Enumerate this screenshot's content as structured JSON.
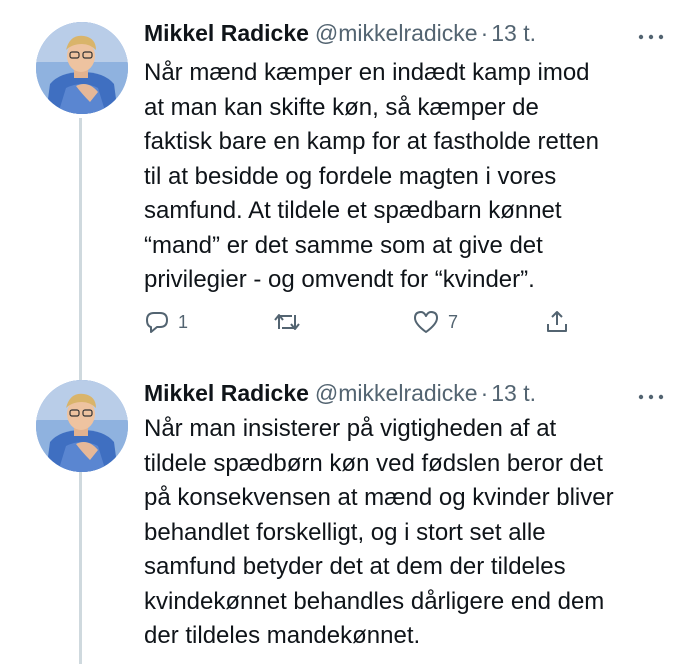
{
  "tweets": [
    {
      "display_name": "Mikkel Radicke",
      "handle": "@mikkelradicke",
      "separator": "·",
      "time": "13 t.",
      "lines": [
        "Når mænd kæmper en indædt kamp imod",
        "at man kan skifte køn, så kæmper de",
        "faktisk bare en kamp for at fastholde retten",
        "til at besidde og fordele magten i vores",
        "samfund. At tildele et spædbarn kønnet",
        "“mand” er det samme som at give det",
        "privilegier - og omvendt for “kvinder”."
      ],
      "actions": {
        "reply_count": "1",
        "retweet_count": "",
        "like_count": "7"
      }
    },
    {
      "display_name": "Mikkel Radicke",
      "handle": "@mikkelradicke",
      "separator": "·",
      "time": "13 t.",
      "lines": [
        "Når man insisterer på vigtigheden af at",
        "tildele spædbørn køn ved fødslen beror det",
        "på konsekvensen at mænd og kvinder bliver",
        "behandlet forskelligt, og i stort set alle",
        "samfund betyder det at dem der tildeles",
        "kvindekønnet behandles dårligere end dem",
        "der tildeles mandekønnet."
      ]
    }
  ],
  "icons": {
    "reply": "reply-icon",
    "retweet": "retweet-icon",
    "like": "like-icon",
    "share": "share-icon",
    "more": "more-icon"
  },
  "colors": {
    "text": "#0f1419",
    "secondary": "#536471",
    "thread_line": "#cfd9de"
  }
}
